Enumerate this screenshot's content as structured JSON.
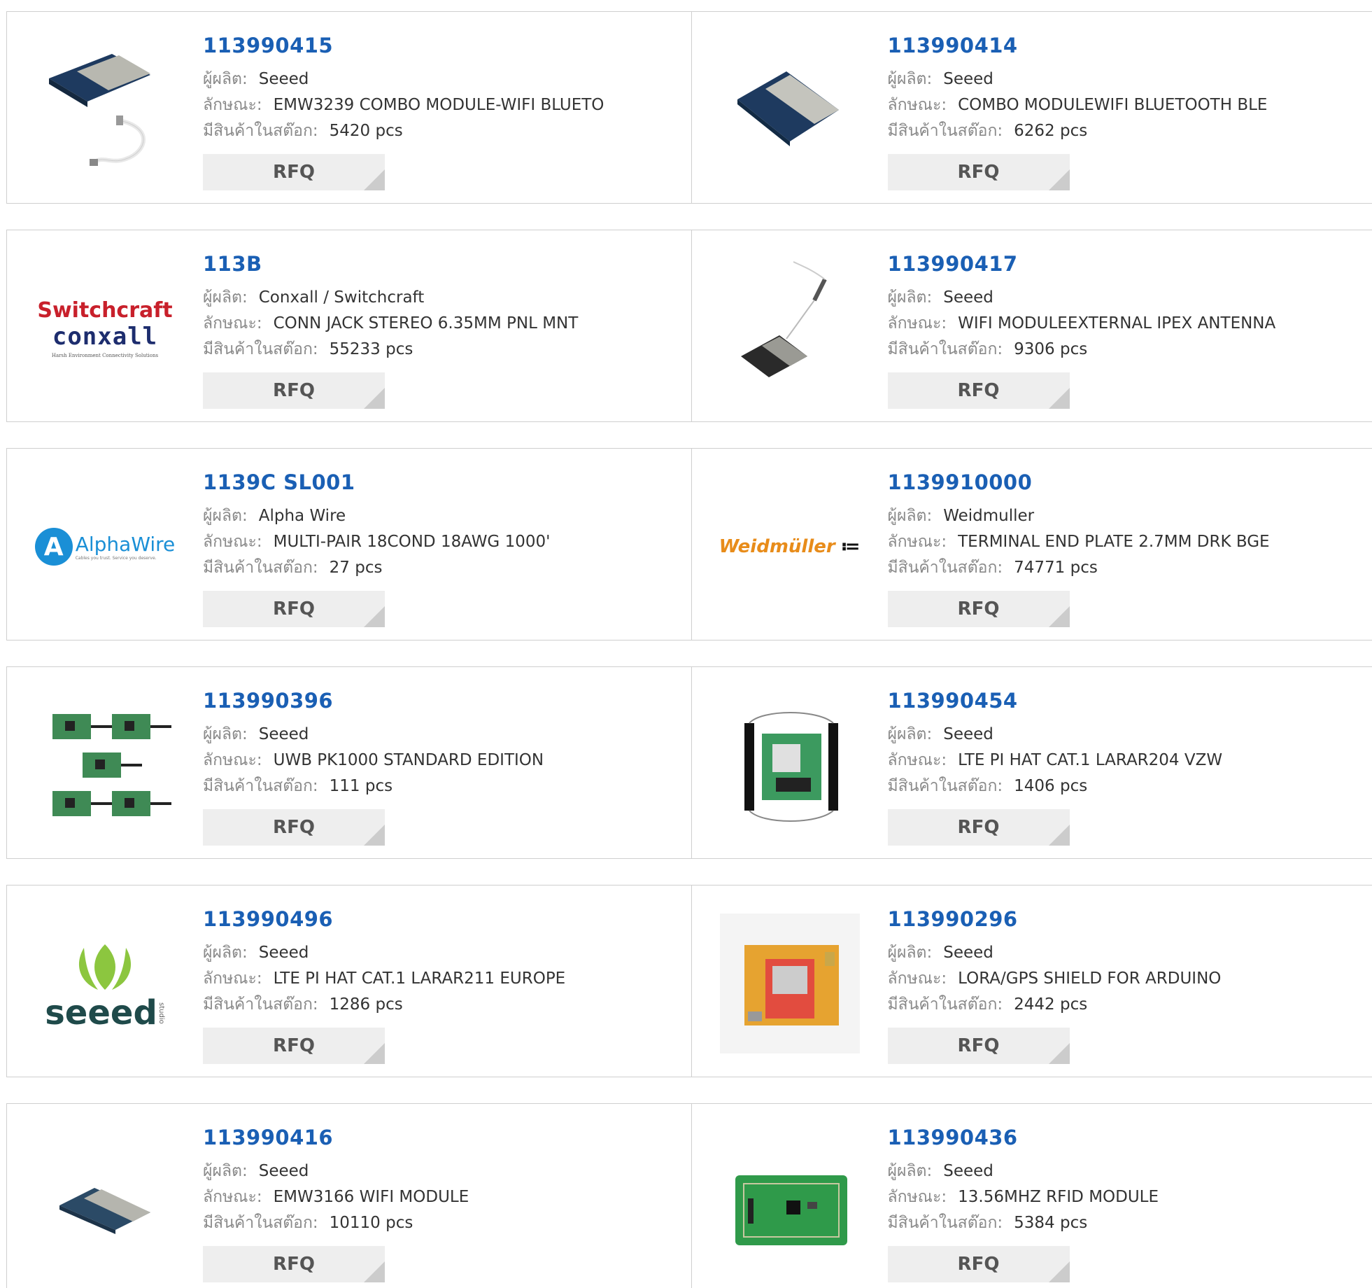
{
  "labels": {
    "manufacturer": "ผู้ผลิต:",
    "description": "ลักษณะ:",
    "stock": "มีสินค้าในสต๊อก:",
    "rfq": "RFQ"
  },
  "products": [
    {
      "part": "113990415",
      "manufacturer": "Seeed",
      "description": "EMW3239 COMBO MODULE-WIFI BLUETO",
      "stock": "5420 pcs",
      "image": "module-with-usb-cable"
    },
    {
      "part": "113990414",
      "manufacturer": "Seeed",
      "description": "COMBO MODULEWIFI BLUETOOTH BLE",
      "stock": "6262 pcs",
      "image": "wifi-module"
    },
    {
      "part": "113B",
      "manufacturer": "Conxall / Switchcraft",
      "description": "CONN JACK STEREO 6.35MM PNL MNT",
      "stock": "55233 pcs",
      "image": "switchcraft-conxall-logo",
      "logo": {
        "line1": "Switchcraft",
        "line2": "conxall",
        "tagline": "Harsh Environment Connectivity Solutions"
      }
    },
    {
      "part": "113990417",
      "manufacturer": "Seeed",
      "description": "WIFI MODULEEXTERNAL IPEX ANTENNA",
      "stock": "9306 pcs",
      "image": "module-with-antenna"
    },
    {
      "part": "1139C SL001",
      "manufacturer": "Alpha Wire",
      "description": "MULTI-PAIR 18COND 18AWG 1000'",
      "stock": "27 pcs",
      "image": "alphawire-logo",
      "logo": {
        "name": "AlphaWire",
        "tagline": "Cables you trust. Service you deserve."
      }
    },
    {
      "part": "1139910000",
      "manufacturer": "Weidmuller",
      "description": "TERMINAL END PLATE 2.7MM DRK BGE",
      "stock": "74771 pcs",
      "image": "weidmuller-logo",
      "logo": {
        "name": "Weidmüller"
      }
    },
    {
      "part": "113990396",
      "manufacturer": "Seeed",
      "description": "UWB PK1000 STANDARD EDITION",
      "stock": "111 pcs",
      "image": "uwb-boards"
    },
    {
      "part": "113990454",
      "manufacturer": "Seeed",
      "description": "LTE PI HAT CAT.1 LARAR204 VZW",
      "stock": "1406 pcs",
      "image": "lte-hat"
    },
    {
      "part": "113990496",
      "manufacturer": "Seeed",
      "description": "LTE PI HAT CAT.1 LARAR211 EUROPE",
      "stock": "1286 pcs",
      "image": "seeed-studio-logo",
      "logo": {
        "name": "seeed",
        "sub": "studio"
      }
    },
    {
      "part": "113990296",
      "manufacturer": "Seeed",
      "description": "LORA/GPS SHIELD FOR ARDUINO",
      "stock": "2442 pcs",
      "image": "lora-gps-shield"
    },
    {
      "part": "113990416",
      "manufacturer": "Seeed",
      "description": "EMW3166 WIFI MODULE",
      "stock": "10110 pcs",
      "image": "small-wifi-module"
    },
    {
      "part": "113990436",
      "manufacturer": "Seeed",
      "description": "13.56MHZ RFID MODULE",
      "stock": "5384 pcs",
      "image": "rfid-module"
    }
  ],
  "colors": {
    "link": "#1a5fb4",
    "label": "#8a8a8a",
    "text": "#333333",
    "button_bg": "#eeeeee",
    "border": "#cfcfcf"
  }
}
